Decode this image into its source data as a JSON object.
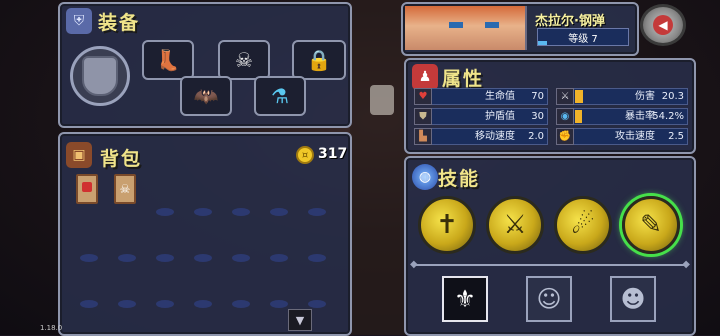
{
  "equipment": {
    "title": "装备",
    "slots": [
      {
        "icon": "boots-icon"
      },
      {
        "icon": "helmet-icon"
      },
      {
        "icon": "locked-icon"
      },
      {
        "icon": "bat-wings-icon"
      },
      {
        "icon": "potion-icon"
      }
    ]
  },
  "bag": {
    "title": "背包",
    "coins": "317",
    "items": [
      {
        "icon": "card-red-icon"
      },
      {
        "icon": "card-skull-icon"
      }
    ]
  },
  "character": {
    "name": "杰拉尔·钢弹",
    "level_label": "等级 7",
    "exp_progress": 0.1
  },
  "attributes": {
    "title": "属性",
    "stats": [
      {
        "label": "生命值",
        "value": "70",
        "icon": "heart-icon"
      },
      {
        "label": "伤害",
        "value": "20.3",
        "icon": "sword-icon",
        "fill": 0.07
      },
      {
        "label": "护盾值",
        "value": "30",
        "icon": "shield-icon"
      },
      {
        "label": "暴击率",
        "value": "54.2%",
        "icon": "eye-icon",
        "fill": 0.06
      },
      {
        "label": "移动速度",
        "value": "2.0",
        "icon": "boot-icon"
      },
      {
        "label": "攻击速度",
        "value": "2.5",
        "icon": "fist-icon"
      }
    ]
  },
  "skills": {
    "title": "技能",
    "items": [
      {
        "icon": "cross-icon"
      },
      {
        "icon": "swords-icon"
      },
      {
        "icon": "fire-icon"
      },
      {
        "icon": "scroll-icon"
      }
    ],
    "portraits": [
      {
        "icon": "knight-helmet-icon"
      },
      {
        "icon": "hero-face-icon"
      },
      {
        "icon": "elder-face-icon"
      }
    ]
  },
  "footer": {
    "version": "1.18.0"
  },
  "colors": {
    "panel_border": "#8f96ad",
    "title_yellow": "#f0e48a",
    "skill_gold": "#f5e24a",
    "selected_green": "#46e04a"
  }
}
